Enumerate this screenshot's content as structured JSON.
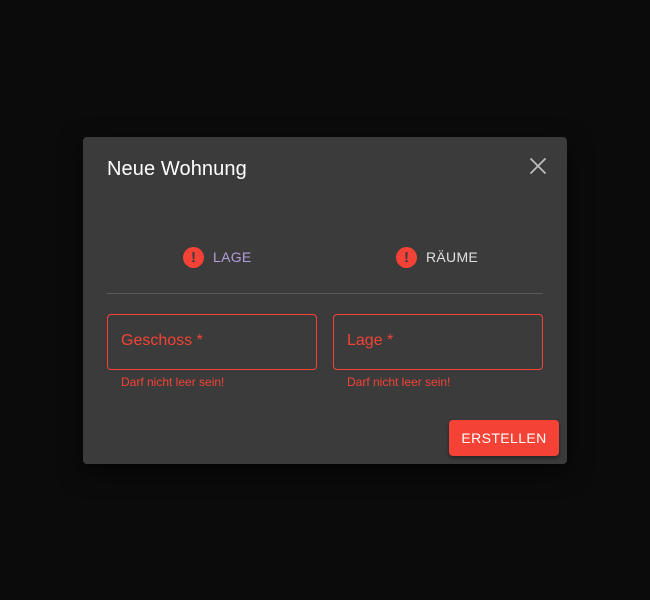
{
  "dialog": {
    "title": "Neue Wohnung",
    "close_icon": "close-icon"
  },
  "stepper": {
    "steps": [
      {
        "label": "LAGE",
        "icon": "error-icon",
        "state": "error",
        "active": true
      },
      {
        "label": "RÄUME",
        "icon": "error-icon",
        "state": "error",
        "active": false
      }
    ]
  },
  "form": {
    "fields": [
      {
        "label": "Geschoss *",
        "value": "",
        "error": "Darf nicht leer sein!"
      },
      {
        "label": "Lage *",
        "value": "",
        "error": "Darf nicht leer sein!"
      }
    ]
  },
  "actions": {
    "submit_label": "ERSTELLEN"
  },
  "colors": {
    "backdrop": "#0b0b0b",
    "dialog_bg": "#3b3b3b",
    "error": "#f44336",
    "active_step": "#b39ddb",
    "text": "#ffffff"
  }
}
